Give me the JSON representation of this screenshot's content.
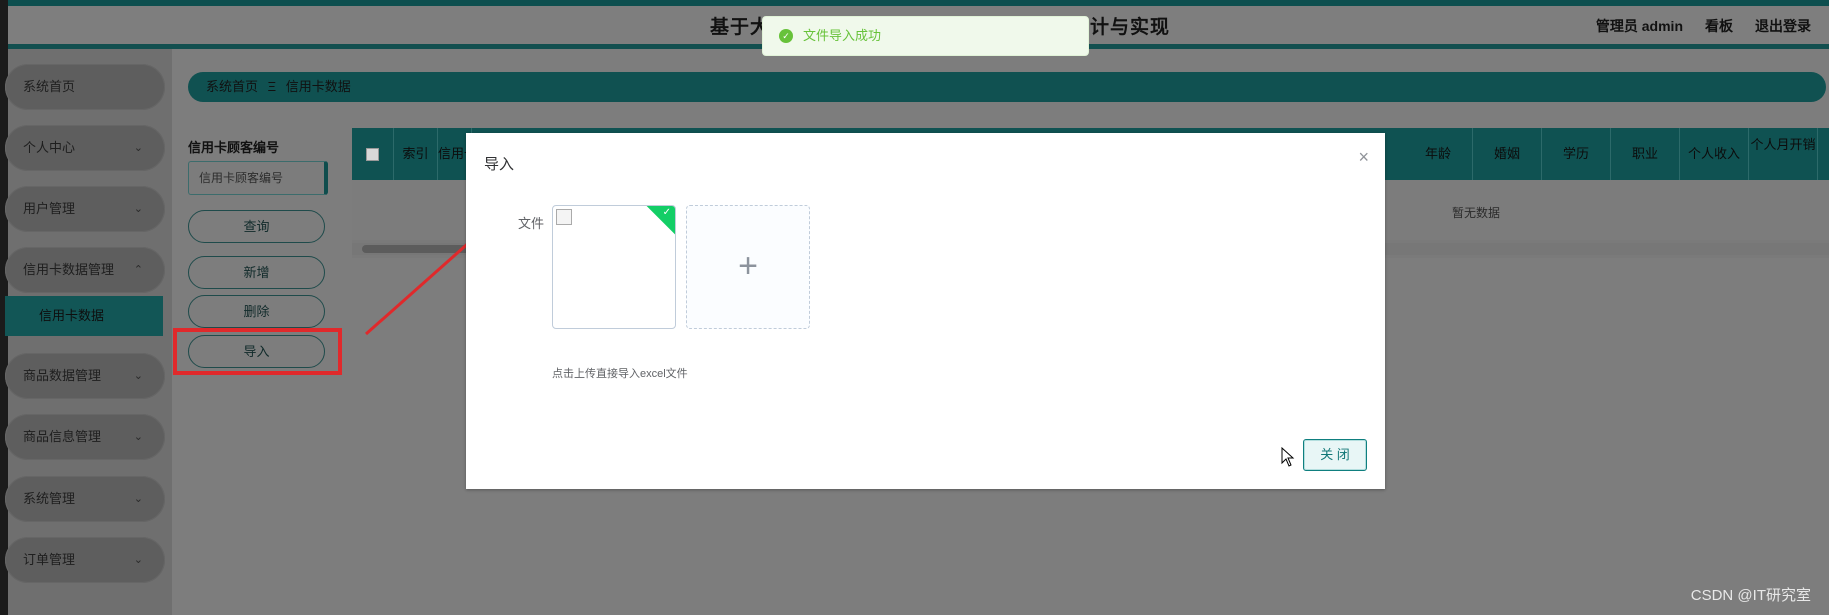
{
  "header": {
    "title_left": "基于大",
    "title_right": "计与实现",
    "user": "管理员 admin",
    "board": "看板",
    "logout": "退出登录"
  },
  "toast": {
    "text": "文件导入成功"
  },
  "sidebar": {
    "items": [
      {
        "label": "系统首页"
      },
      {
        "label": "个人中心",
        "chevron": "⌄"
      },
      {
        "label": "用户管理",
        "chevron": "⌄"
      },
      {
        "label": "信用卡数据管理",
        "chevron": "⌃"
      },
      {
        "label": "信用卡数据"
      },
      {
        "label": "商品数据管理",
        "chevron": "⌄"
      },
      {
        "label": "商品信息管理",
        "chevron": "⌄"
      },
      {
        "label": "系统管理",
        "chevron": "⌄"
      },
      {
        "label": "订单管理",
        "chevron": "⌄"
      }
    ]
  },
  "breadcrumb": {
    "home": "系统首页",
    "separator": "Ξ",
    "current": "信用卡数据"
  },
  "search": {
    "label": "信用卡顾客编号",
    "placeholder": "信用卡顾客编号",
    "query_label": "查询",
    "add_label": "新增",
    "delete_label": "删除",
    "import_label": "导入"
  },
  "table": {
    "columns_left": [
      "索引",
      "信用卡顾客"
    ],
    "columns_right": [
      "年龄",
      "婚姻",
      "学历",
      "职业",
      "个人收入",
      "个人月开销"
    ],
    "empty_text": "暂无数据"
  },
  "modal": {
    "title": "导入",
    "close_icon": "×",
    "field_label": "文件",
    "plus": "+",
    "tip": "点击上传直接导入excel文件",
    "close_button": "关 闭"
  },
  "watermark": "CSDN @IT研究室",
  "colors": {
    "accent": "#0f5252",
    "success": "#13ce66",
    "annotation": "#e0292b"
  }
}
